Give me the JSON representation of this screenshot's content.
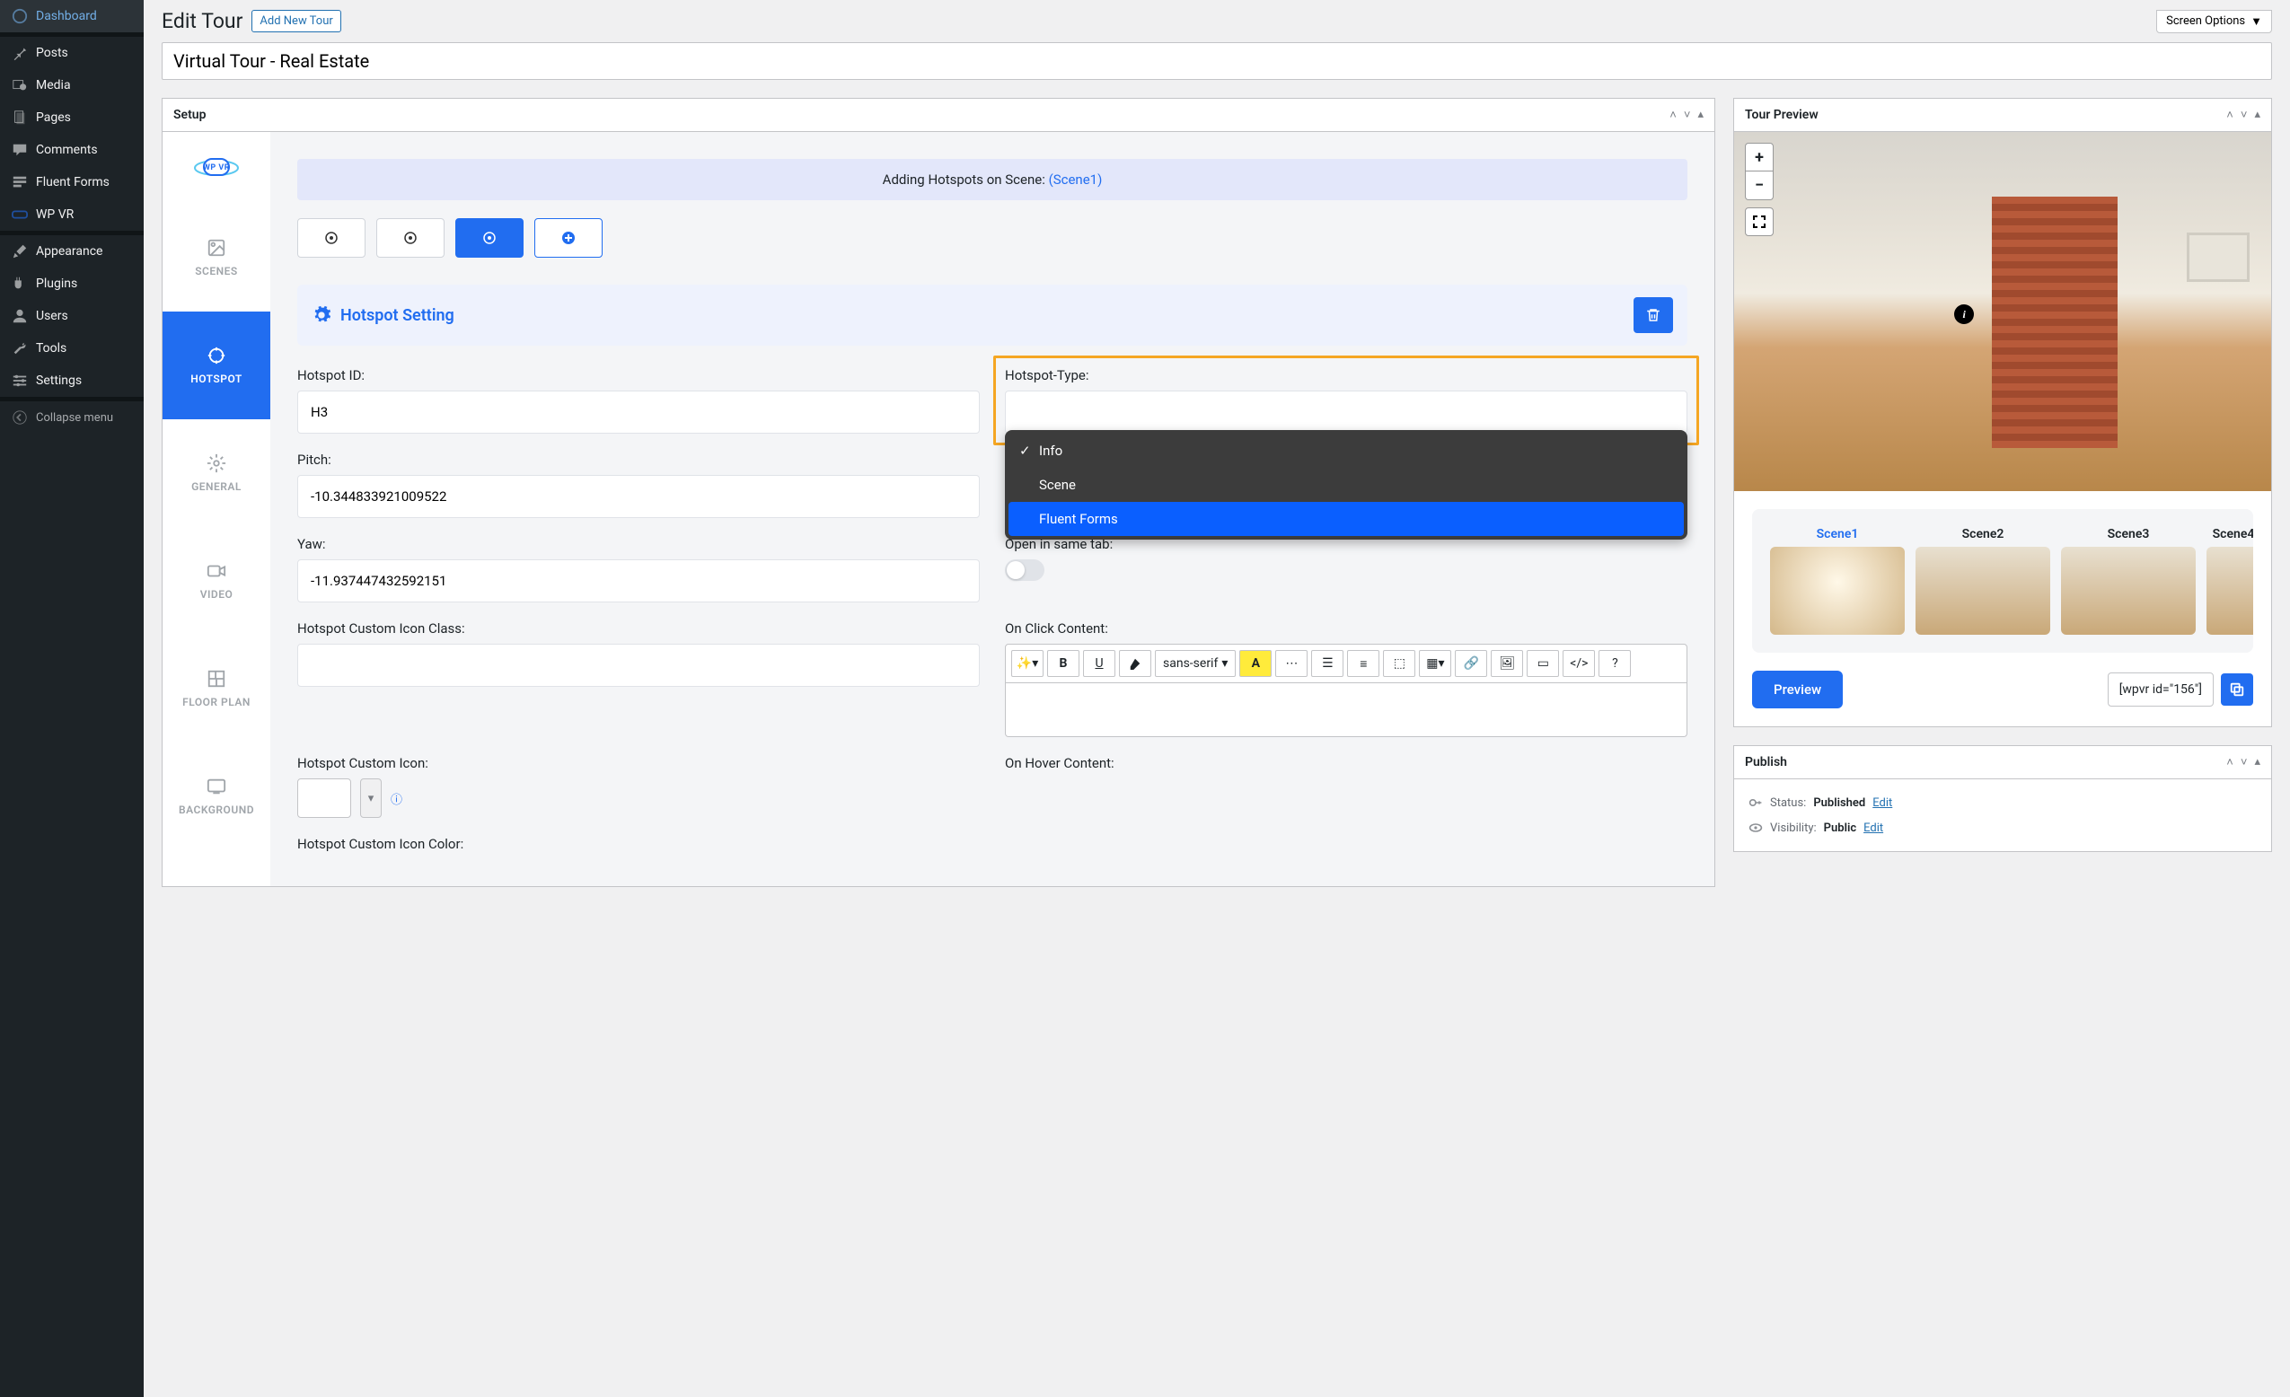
{
  "sidebar": {
    "items": [
      {
        "label": "Dashboard",
        "icon": "dashboard"
      },
      {
        "label": "Posts",
        "icon": "pin"
      },
      {
        "label": "Media",
        "icon": "media"
      },
      {
        "label": "Pages",
        "icon": "page"
      },
      {
        "label": "Comments",
        "icon": "comment"
      },
      {
        "label": "Fluent Forms",
        "icon": "form"
      },
      {
        "label": "WP VR",
        "icon": "vr"
      },
      {
        "label": "Appearance",
        "icon": "brush"
      },
      {
        "label": "Plugins",
        "icon": "plugin"
      },
      {
        "label": "Users",
        "icon": "user"
      },
      {
        "label": "Tools",
        "icon": "wrench"
      },
      {
        "label": "Settings",
        "icon": "settings"
      }
    ],
    "collapse": "Collapse menu"
  },
  "header": {
    "title": "Edit Tour",
    "add_new": "Add New Tour",
    "screen_options": "Screen Options"
  },
  "tour_title": "Virtual Tour - Real Estate",
  "setup": {
    "panel_title": "Setup",
    "tabs": {
      "scenes": "SCENES",
      "hotspot": "HOTSPOT",
      "general": "GENERAL",
      "video": "VIDEO",
      "floor_plan": "FLOOR PLAN",
      "background": "BACKGROUND"
    },
    "notice_prefix": "Adding Hotspots on Scene: ",
    "notice_scene": "(Scene1)",
    "hotspot_setting_title": "Hotspot Setting",
    "fields": {
      "hotspot_id_label": "Hotspot ID:",
      "hotspot_id_value": "H3",
      "hotspot_type_label": "Hotspot-Type:",
      "hotspot_type_options": [
        "Info",
        "Scene",
        "Fluent Forms"
      ],
      "pitch_label": "Pitch:",
      "pitch_value": "-10.344833921009522",
      "yaw_label": "Yaw:",
      "yaw_value": "-11.937447432592151",
      "open_same_tab_label": "Open in same tab:",
      "on_click_label": "On Click Content:",
      "on_hover_label": "On Hover Content:",
      "custom_icon_class_label": "Hotspot Custom Icon Class:",
      "custom_icon_label": "Hotspot Custom Icon:",
      "custom_icon_color_label": "Hotspot Custom Icon Color:",
      "editor_font": "sans-serif"
    }
  },
  "preview": {
    "panel_title": "Tour Preview",
    "scenes": [
      "Scene1",
      "Scene2",
      "Scene3",
      "Scene4"
    ],
    "preview_button": "Preview",
    "shortcode": "[wpvr id=\"156\"]"
  },
  "publish": {
    "panel_title": "Publish",
    "status_label": "Status:",
    "status_value": "Published",
    "visibility_label": "Visibility:",
    "visibility_value": "Public",
    "edit_label": "Edit"
  }
}
